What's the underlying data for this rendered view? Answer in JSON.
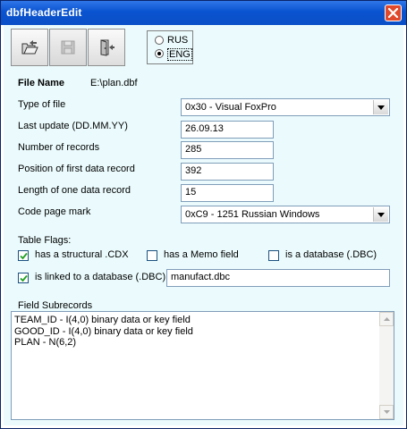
{
  "window": {
    "title": "dbfHeaderEdit"
  },
  "toolbar": {
    "open_icon": "open-folder-arrow-icon",
    "save_icon": "save-disk-icon",
    "exit_icon": "exit-door-icon"
  },
  "language": {
    "options": [
      "RUS",
      "ENG"
    ],
    "selected": "ENG"
  },
  "file": {
    "label": "File Name",
    "value": "E:\\plan.dbf"
  },
  "fields": {
    "type_label": "Type of file",
    "type_value": "0x30 - Visual FoxPro",
    "last_update_label": "Last update (DD.MM.YY)",
    "last_update_value": "26.09.13",
    "num_records_label": "Number of records",
    "num_records_value": "285",
    "first_pos_label": "Position of first data record",
    "first_pos_value": "392",
    "rec_len_label": "Length of one data record",
    "rec_len_value": "15",
    "codepage_label": "Code page mark",
    "codepage_value": "0xC9 - 1251  Russian Windows"
  },
  "flags": {
    "label": "Table Flags:",
    "cdx_label": "has a structural .CDX",
    "cdx_checked": true,
    "memo_label": "has a Memo field",
    "memo_checked": false,
    "database_label": "is a database (.DBC)",
    "database_checked": false,
    "linked_label": "is linked to a database (.DBC):",
    "linked_checked": true,
    "linked_value": "manufact.dbc"
  },
  "subrecords": {
    "label": "Field Subrecords",
    "lines": [
      "TEAM_ID - I(4,0) binary data or key field",
      "GOOD_ID - I(4,0) binary data or key field",
      "PLAN - N(6,2)"
    ]
  },
  "colors": {
    "titlebar": "#0a53d0",
    "client_background": "#ebfbfd",
    "close_button": "#e0492b"
  }
}
